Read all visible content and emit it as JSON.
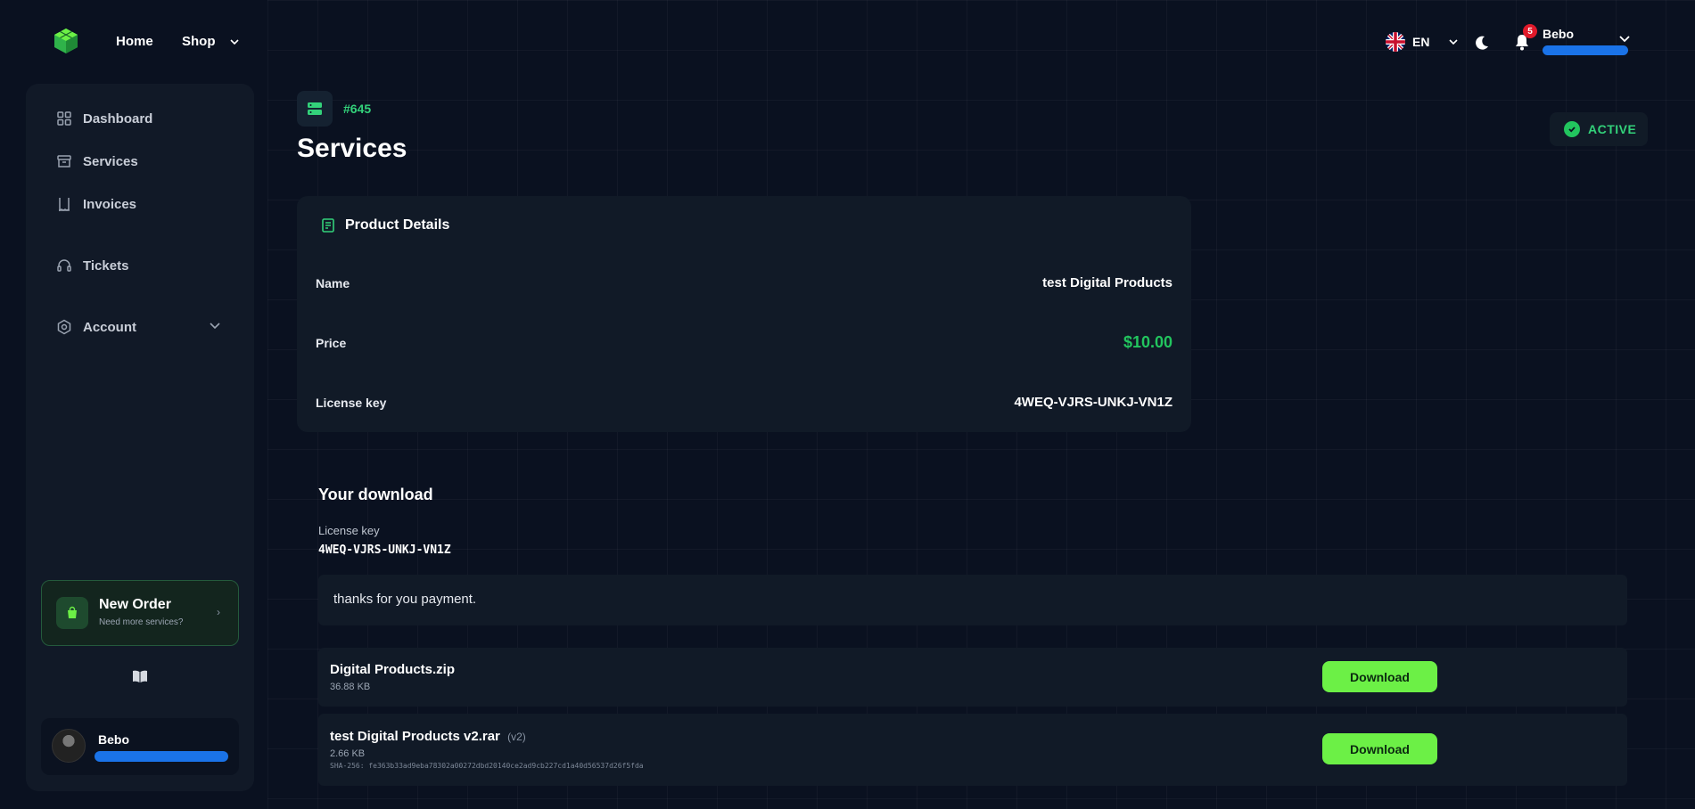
{
  "nav": {
    "home": "Home",
    "shop": "Shop",
    "lang": "EN",
    "notif_count": "5",
    "user_name": "Bebo"
  },
  "sidebar": {
    "items": [
      {
        "label": "Dashboard",
        "icon": "grid-icon"
      },
      {
        "label": "Services",
        "icon": "box-icon"
      },
      {
        "label": "Invoices",
        "icon": "receipt-icon"
      },
      {
        "label": "Tickets",
        "icon": "headset-icon"
      },
      {
        "label": "Account",
        "icon": "gear-icon"
      }
    ],
    "new_order": {
      "title": "New Order",
      "subtitle": "Need more services?"
    },
    "user_name": "Bebo"
  },
  "service": {
    "id": "#645",
    "title": "Services",
    "status": "ACTIVE"
  },
  "product": {
    "card_title": "Product Details",
    "rows": [
      {
        "label": "Name",
        "value": "test Digital Products"
      },
      {
        "label": "Price",
        "value": "$10.00"
      },
      {
        "label": "License key",
        "value": "4WEQ-VJRS-UNKJ-VN1Z"
      }
    ]
  },
  "download": {
    "title": "Your download",
    "license_label": "License key",
    "license_value": "4WEQ-VJRS-UNKJ-VN1Z",
    "note": "thanks for you payment.",
    "files": [
      {
        "name": "Digital Products.zip",
        "version": "",
        "size": "36.88 KB",
        "sha": "",
        "button": "Download"
      },
      {
        "name": "test Digital Products v2.rar",
        "version": "(v2)",
        "size": "2.66 KB",
        "sha": "SHA-256: fe363b33ad9eba78302a00272dbd20140ce2ad9cb227cd1a40d56537d26f5fda",
        "button": "Download"
      }
    ]
  },
  "colors": {
    "background": "#0a1120",
    "card": "#111a27",
    "accent_green": "#22c55e",
    "button_green": "#6cf046",
    "badge_red": "#e0192a"
  }
}
